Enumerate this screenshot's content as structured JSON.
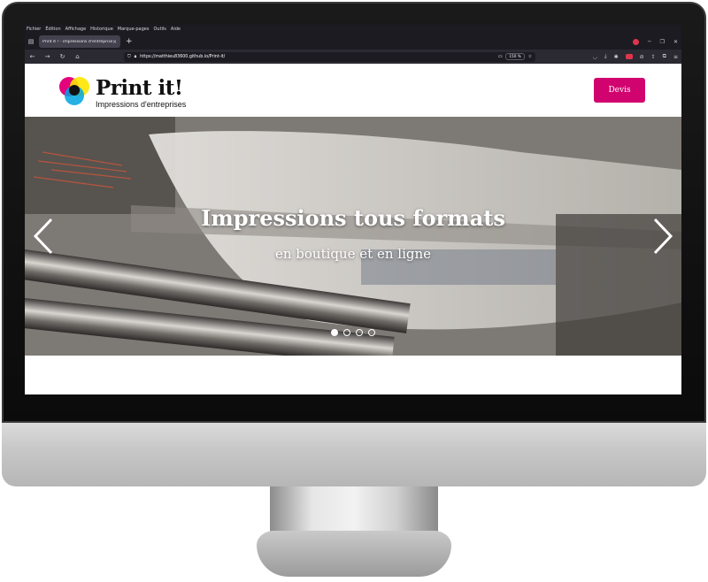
{
  "browser": {
    "menu": [
      "Fichier",
      "Édition",
      "Affichage",
      "Historique",
      "Marque-pages",
      "Outils",
      "Aide"
    ],
    "tab_title": "Print it ! - impressions d'entreprises",
    "url": "https://matthieu83600.github.io/Print-it/",
    "zoom": "150 %"
  },
  "header": {
    "brand": "Print it!",
    "tagline": "Impressions d'entreprises",
    "devis_label": "Devis"
  },
  "hero": {
    "title": "Impressions tous formats",
    "subtitle": "en boutique et en ligne",
    "slide_count": 4,
    "active_slide": 1
  },
  "colors": {
    "accent": "#d1036f",
    "browser_dark": "#1c1b22"
  }
}
